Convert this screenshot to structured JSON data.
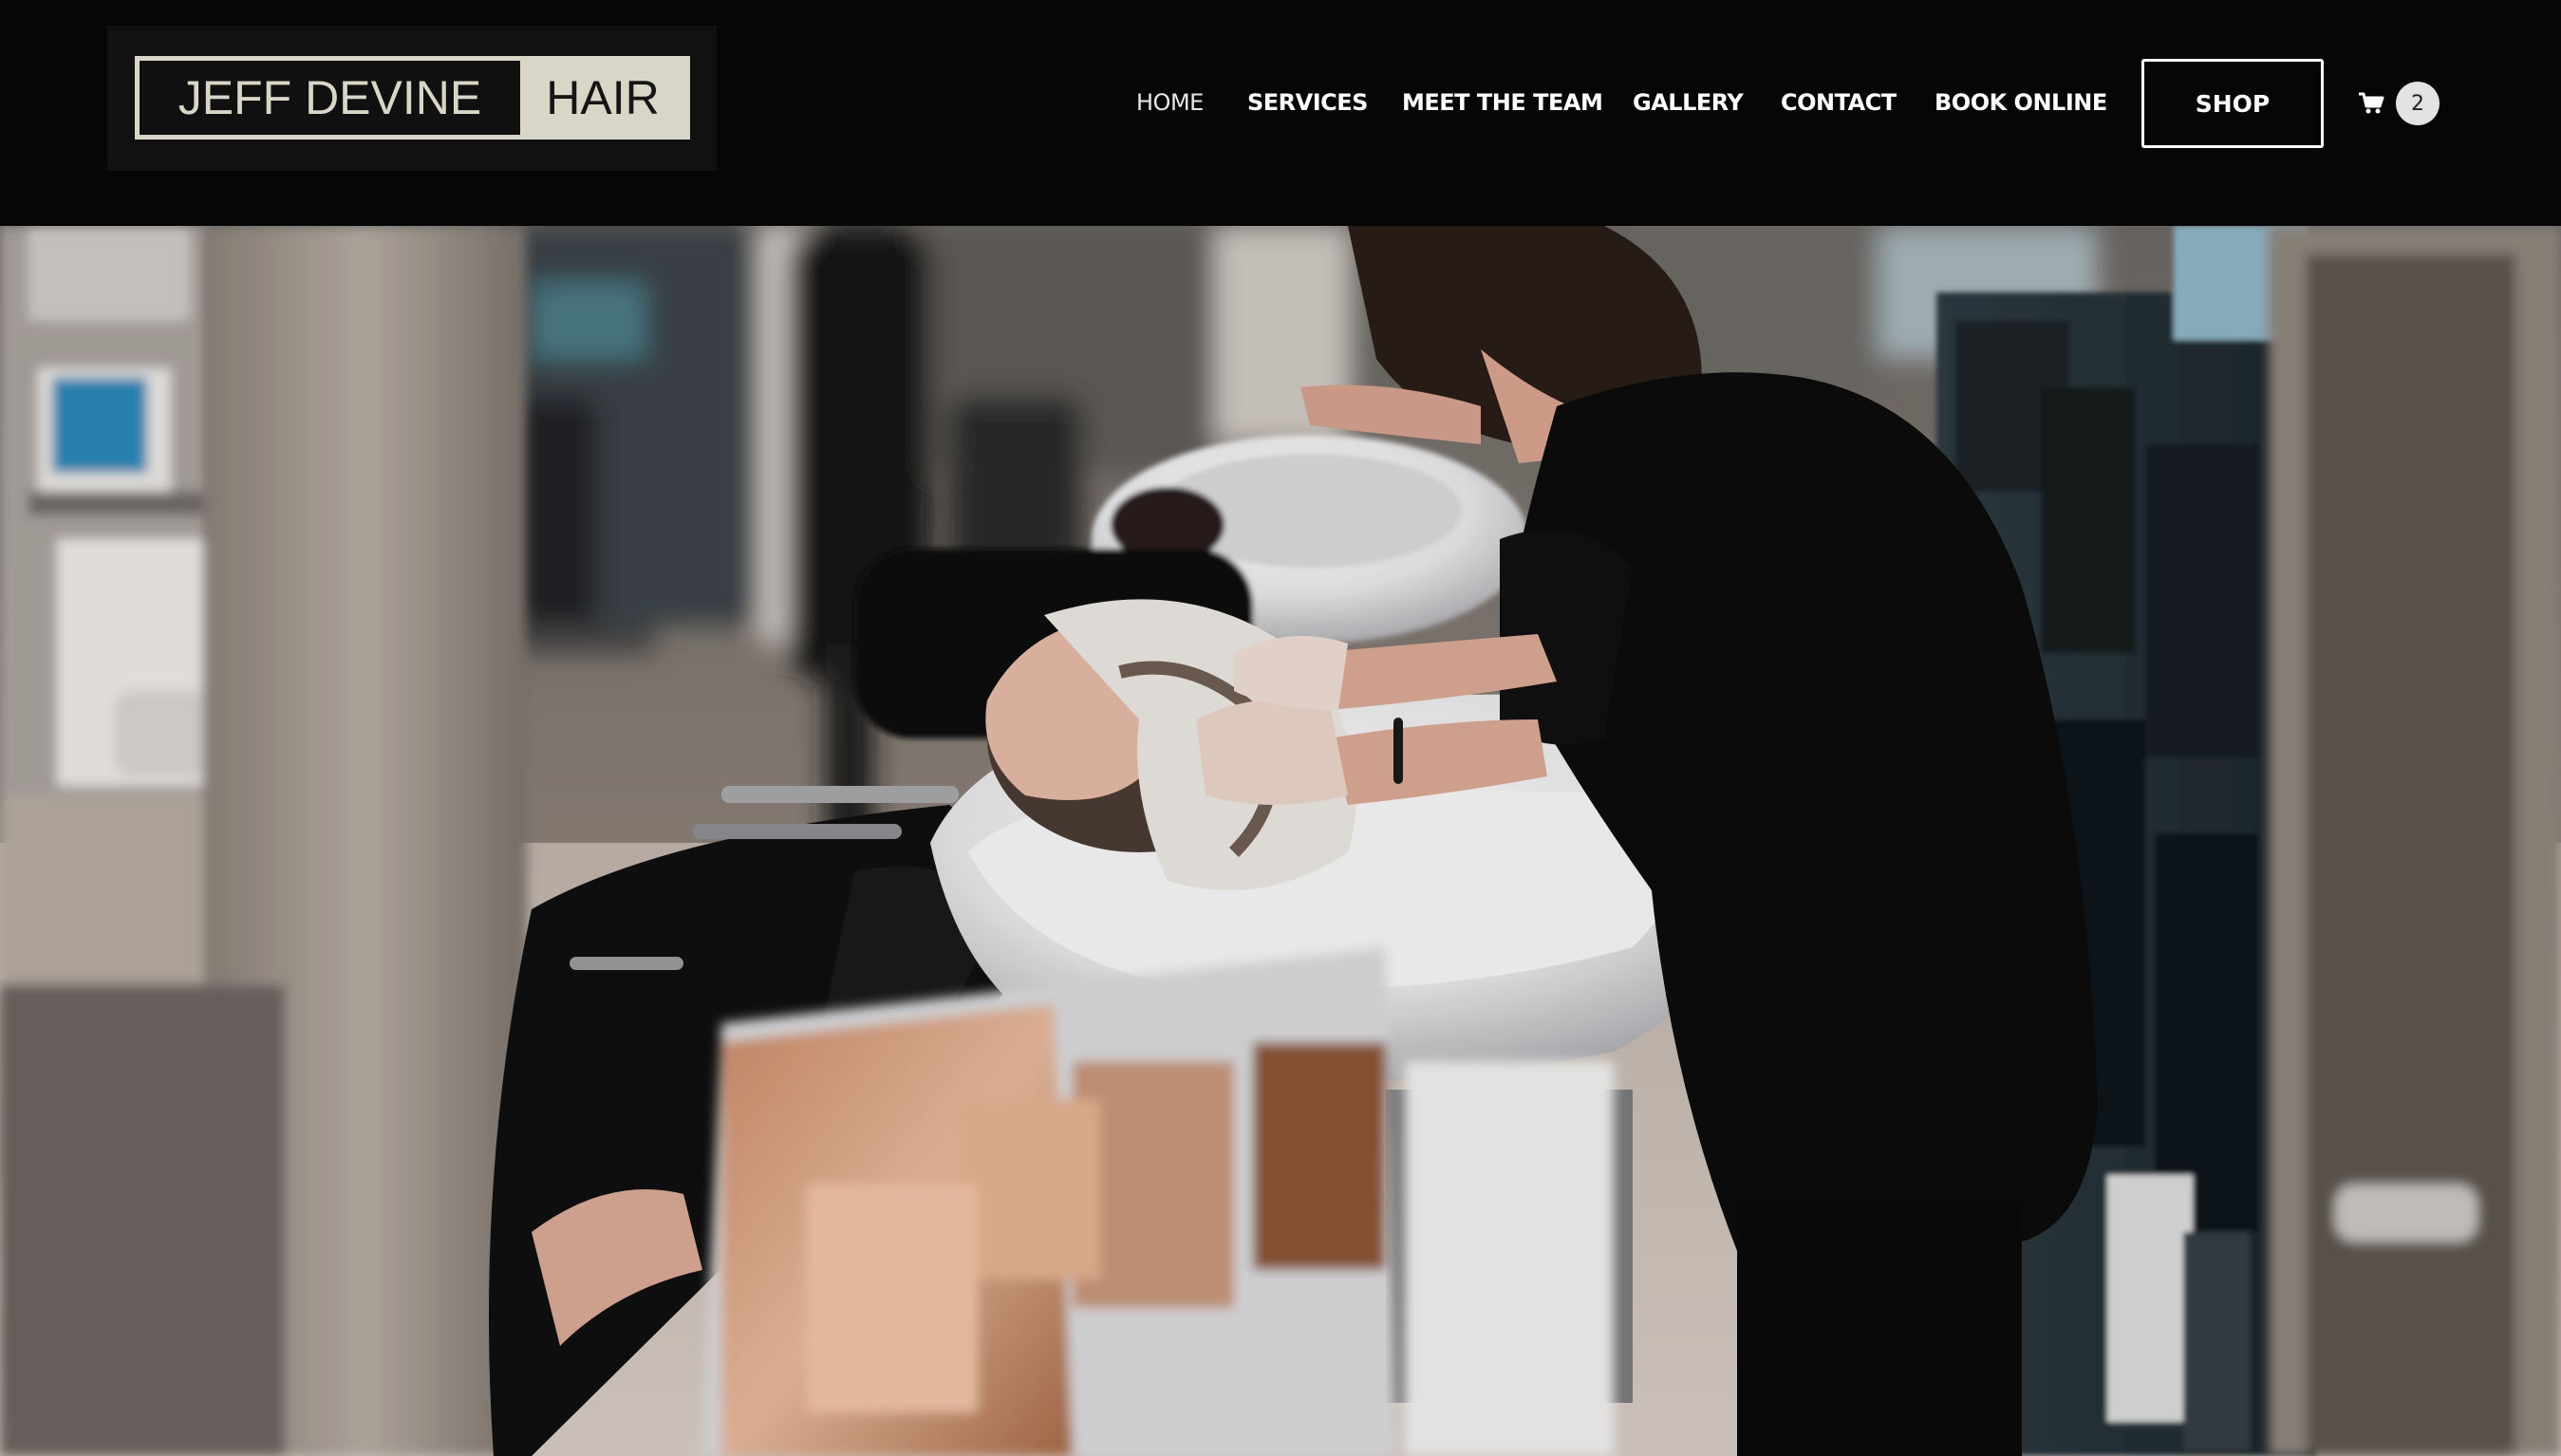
{
  "brand": {
    "logo_left": "JEFF DEVINE",
    "logo_right": "HAIR"
  },
  "nav": {
    "items": [
      {
        "label": "HOME",
        "active": true
      },
      {
        "label": "SERVICES",
        "active": false
      },
      {
        "label": "MEET THE TEAM",
        "active": false
      },
      {
        "label": "GALLERY",
        "active": false
      },
      {
        "label": "CONTACT",
        "active": false
      },
      {
        "label": "BOOK ONLINE",
        "active": false
      }
    ],
    "shop_label": "SHOP"
  },
  "cart": {
    "icon": "shopping-cart-icon",
    "count": "2"
  },
  "hero": {
    "type": "photo"
  },
  "colors": {
    "header_bg": "#060606",
    "logo_cream": "#d9d6c7",
    "nav_text": "#ffffff"
  }
}
